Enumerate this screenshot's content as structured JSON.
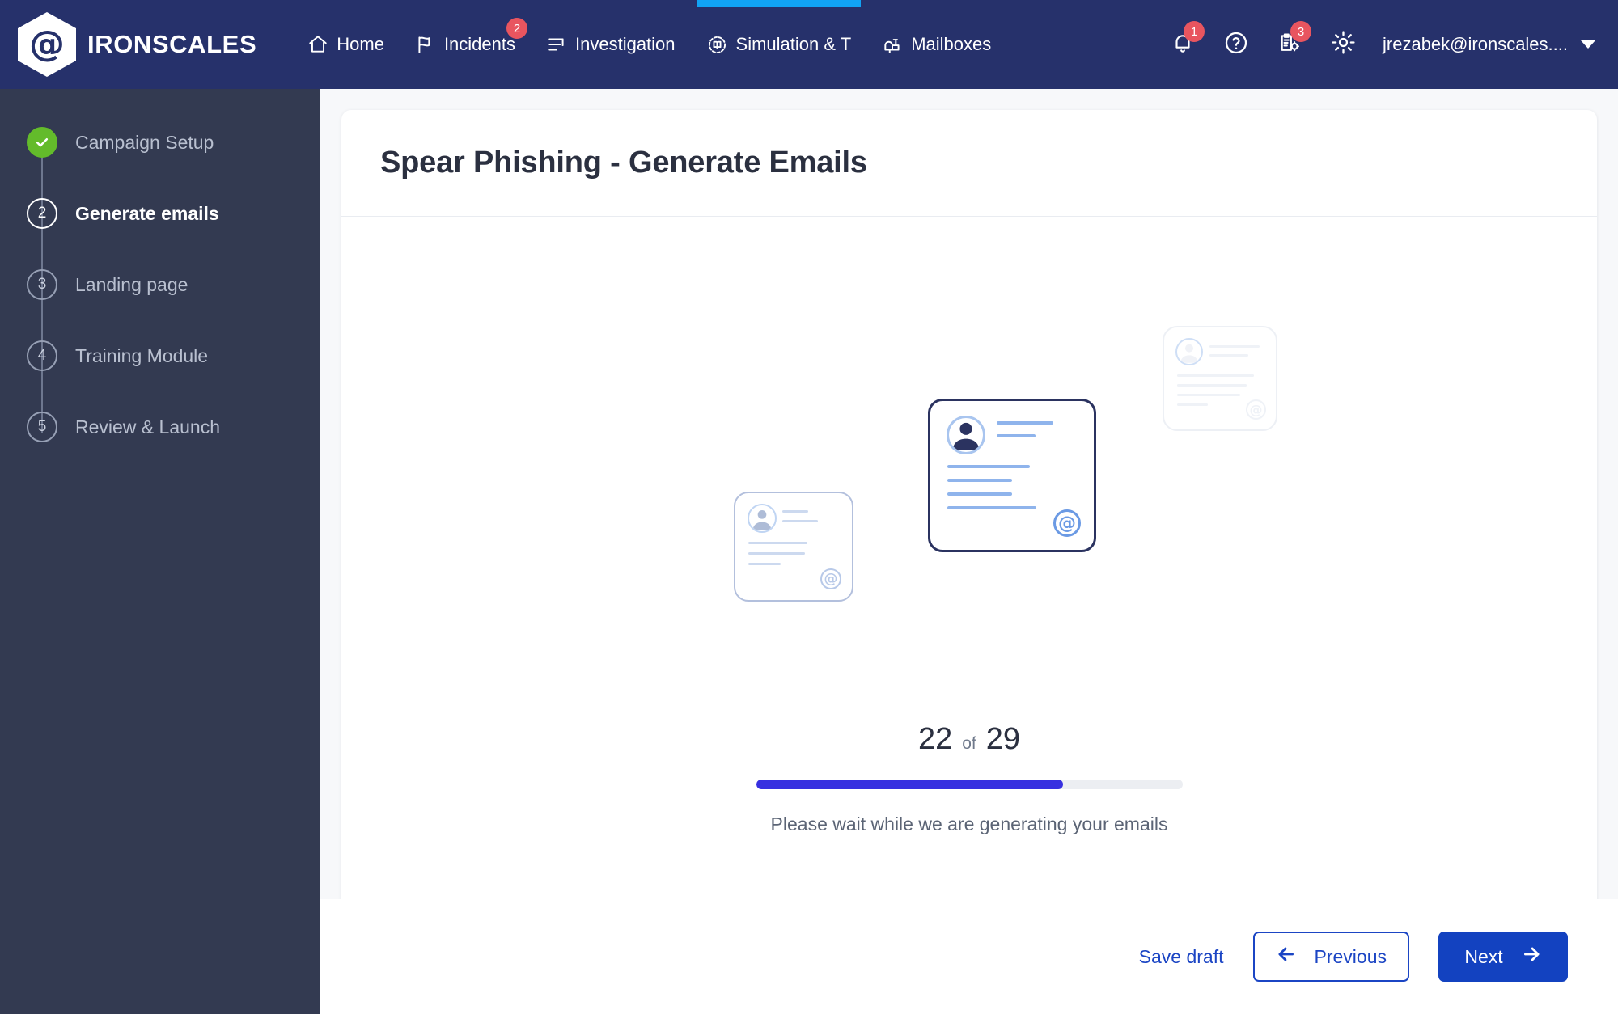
{
  "topbar": {
    "brand": {
      "logo_icon": "at-hexagon-logo-icon",
      "name": "IRONSCALES"
    },
    "nav_items": [
      {
        "label": "Home",
        "icon": "home-icon",
        "badge": null,
        "active": false
      },
      {
        "label": "Incidents",
        "icon": "flag-icon",
        "badge": "2",
        "active": false
      },
      {
        "label": "Investigation",
        "icon": "list-lines-icon",
        "badge": null,
        "active": false
      },
      {
        "label": "Simulation & T",
        "icon": "target-book-icon",
        "badge": null,
        "active": true
      },
      {
        "label": "Mailboxes",
        "icon": "mailbox-icon",
        "badge": null,
        "active": false
      }
    ],
    "right_icons": [
      {
        "name": "notifications-bell-icon",
        "badge": "1"
      },
      {
        "name": "help-circle-icon",
        "badge": null
      },
      {
        "name": "clipboard-gear-icon",
        "badge": "3"
      },
      {
        "name": "settings-gear-icon",
        "badge": null
      }
    ],
    "user": {
      "email": "jrezabek@ironscales....",
      "caret_icon": "chevron-down-icon"
    },
    "active_indicator_color": "#11a3f5",
    "background_color": "#26316b",
    "badge_color": "#e8555f"
  },
  "sidebar": {
    "background_color": "#333a51",
    "steps": [
      {
        "number": "1",
        "label": "Campaign Setup",
        "state": "done",
        "marker": "check-icon"
      },
      {
        "number": "2",
        "label": "Generate emails",
        "state": "current",
        "marker": "2"
      },
      {
        "number": "3",
        "label": "Landing page",
        "state": "todo",
        "marker": "3"
      },
      {
        "number": "4",
        "label": "Training Module",
        "state": "todo",
        "marker": "4"
      },
      {
        "number": "5",
        "label": "Review & Launch",
        "state": "todo",
        "marker": "5"
      }
    ],
    "done_color": "#63bb2b"
  },
  "main": {
    "title": "Spear Phishing - Generate Emails",
    "illustration": {
      "cards": [
        {
          "name": "email-card-back",
          "avatar_icon": "person-avatar-icon",
          "at_icon": "at-icon"
        },
        {
          "name": "email-card-front",
          "avatar_icon": "person-avatar-icon",
          "at_icon": "at-icon"
        },
        {
          "name": "email-card-middle",
          "avatar_icon": "person-avatar-icon",
          "at_icon": "at-icon"
        }
      ]
    },
    "progress": {
      "current": "22",
      "of_label": "of",
      "total": "29",
      "percent": 72,
      "fill_color": "#3730e0",
      "track_color": "#eceef2",
      "status_text": "Please wait while we are generating your emails"
    }
  },
  "footer": {
    "save_draft_label": "Save draft",
    "previous_label": "Previous",
    "previous_icon": "arrow-left-icon",
    "next_label": "Next",
    "next_icon": "arrow-right-icon",
    "primary_color": "#1342c0"
  }
}
